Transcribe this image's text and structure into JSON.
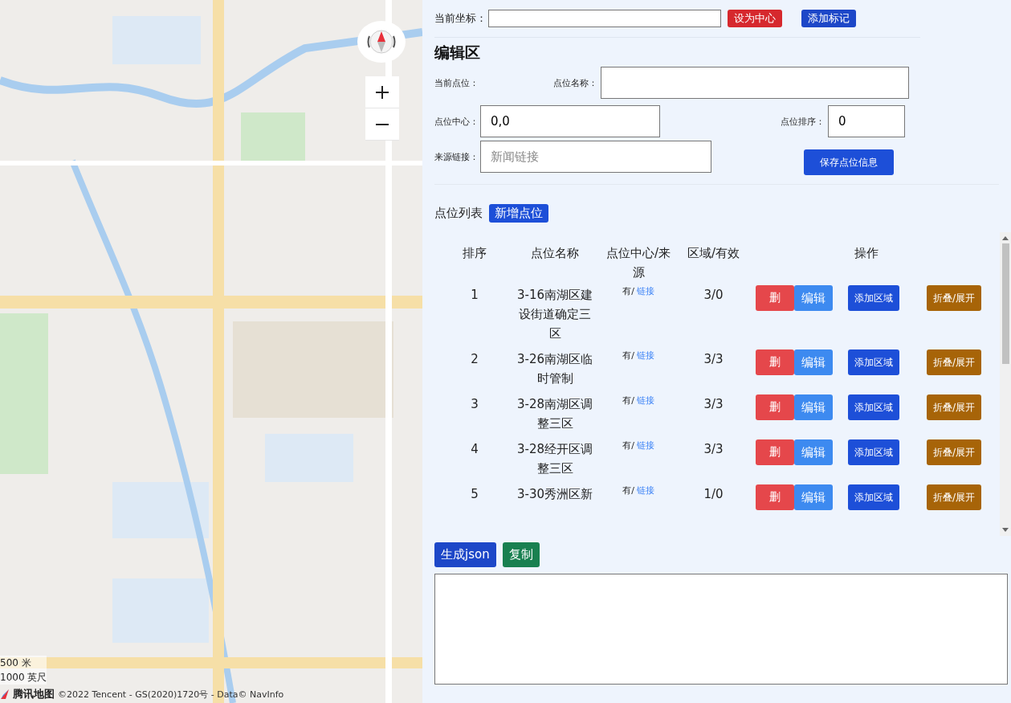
{
  "map": {
    "scale": {
      "metric": "500 米",
      "imperial": "1000 英尺"
    },
    "brand": "腾讯地图",
    "attribution": "©2022 Tencent - GS(2020)1720号 - Data© NavInfo"
  },
  "coords": {
    "label": "当前坐标：",
    "buttons": [
      {
        "label": "设为中心",
        "kind": "danger"
      },
      {
        "label": "添加标记",
        "kind": "primary"
      }
    ]
  },
  "editor": {
    "title": "编辑区",
    "current_label": "当前点位：",
    "name_label": "点位名称：",
    "center_label": "点位中心：",
    "center_value": "0,0",
    "order_label": "点位排序：",
    "order_value": "0",
    "source_label": "来源链接：",
    "source_placeholder": "新闻链接",
    "save": "保存点位信息"
  },
  "list": {
    "title": "点位列表",
    "add": "新增点位",
    "columns": [
      "排序",
      "点位名称",
      "点位中心/来源",
      "区域/有效",
      "操作"
    ],
    "rows": [
      {
        "order": "1",
        "name": "3-16南湖区建设街道确定三区",
        "source": "有/",
        "link": "链接",
        "areas": "3/0",
        "actions": [
          {
            "label": "删",
            "kind": "delete"
          },
          {
            "label": "编辑",
            "kind": "edit"
          },
          {
            "label": "添加区域",
            "kind": "add"
          },
          {
            "label": "折叠/展开",
            "kind": "toggle"
          }
        ]
      },
      {
        "order": "2",
        "name": "3-26南湖区临时管制",
        "source": "有/",
        "link": "链接",
        "areas": "3/3",
        "actions": [
          {
            "label": "删",
            "kind": "delete"
          },
          {
            "label": "编辑",
            "kind": "edit"
          },
          {
            "label": "添加区域",
            "kind": "add"
          },
          {
            "label": "折叠/展开",
            "kind": "toggle"
          }
        ]
      },
      {
        "order": "3",
        "name": "3-28南湖区调整三区",
        "source": "有/",
        "link": "链接",
        "areas": "3/3",
        "actions": [
          {
            "label": "删",
            "kind": "delete"
          },
          {
            "label": "编辑",
            "kind": "edit"
          },
          {
            "label": "添加区域",
            "kind": "add"
          },
          {
            "label": "折叠/展开",
            "kind": "toggle"
          }
        ]
      },
      {
        "order": "4",
        "name": "3-28经开区调整三区",
        "source": "有/",
        "link": "链接",
        "areas": "3/3",
        "actions": [
          {
            "label": "删",
            "kind": "delete"
          },
          {
            "label": "编辑",
            "kind": "edit"
          },
          {
            "label": "添加区域",
            "kind": "add"
          },
          {
            "label": "折叠/展开",
            "kind": "toggle"
          }
        ]
      },
      {
        "order": "5",
        "name": "3-30秀洲区新",
        "source": "有/",
        "link": "链接",
        "areas": "1/0",
        "actions": [
          {
            "label": "删",
            "kind": "delete"
          },
          {
            "label": "编辑",
            "kind": "edit"
          },
          {
            "label": "添加区域",
            "kind": "add"
          },
          {
            "label": "折叠/展开",
            "kind": "toggle"
          }
        ]
      }
    ]
  },
  "output": {
    "buttons": [
      {
        "label": "生成json",
        "kind": "primary"
      },
      {
        "label": "复制",
        "kind": "success"
      }
    ]
  }
}
